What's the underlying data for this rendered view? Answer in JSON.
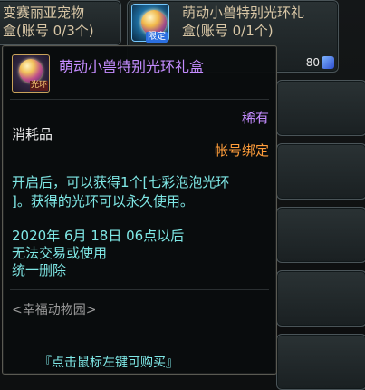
{
  "shop": {
    "item_left": {
      "title_line1": "变赛丽亚宠物",
      "title_line2": "盒(账号 0/3个)"
    },
    "item_right": {
      "title_line1": "萌动小兽特别光环礼",
      "title_line2": "盒(账号 0/1个)",
      "badge": "限定",
      "price": "80"
    }
  },
  "tooltip": {
    "icon_label": "光环",
    "title": "萌动小兽特别光环礼盒",
    "rarity": "稀有",
    "type": "消耗品",
    "bind": "帐号绑定",
    "description_line1": "开启后，可以获得1个[七彩泡泡光环",
    "description_line2": "]。获得的光环可以永久使用。",
    "expire_line1": "2020年 6月 18日 06点以后",
    "expire_line2": "无法交易或使用",
    "expire_line3": "统一删除",
    "shop_name": "<幸福动物园>",
    "hint": "『点击鼠标左键可购买』"
  },
  "colors": {
    "title": "#c48cff",
    "bind": "#ff9d3a",
    "desc": "#7fe8e6"
  }
}
